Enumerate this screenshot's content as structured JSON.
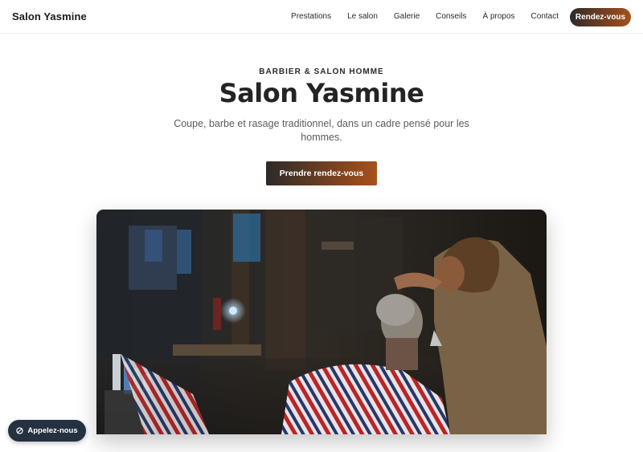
{
  "header": {
    "brand": "Salon Yasmine",
    "nav": [
      {
        "label": "Prestations"
      },
      {
        "label": "Le salon"
      },
      {
        "label": "Galerie"
      },
      {
        "label": "Conseils"
      },
      {
        "label": "À propos"
      },
      {
        "label": "Contact"
      }
    ],
    "cta_label": "Rendez-vous"
  },
  "hero": {
    "eyebrow": "BARBIER & SALON HOMME",
    "title": "Salon Yasmine",
    "subtitle": "Coupe, barbe et rasage traditionnel, dans un cadre pensé pour les hommes.",
    "cta_label": "Prendre rendez-vous",
    "image_icon": "barbershop-photo"
  },
  "floating": {
    "call_label": "Appelez-nous",
    "call_icon": "phone-icon"
  },
  "colors": {
    "accent_dark": "#2c2a29",
    "accent_orange": "#a8511c",
    "pill_navy": "#243140"
  }
}
